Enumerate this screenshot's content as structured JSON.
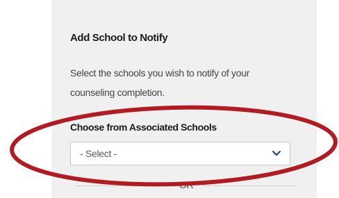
{
  "panel": {
    "title": "Add School to Notify",
    "description": "Select the schools you wish to notify of your counseling completion.",
    "associated_schools_label": "Choose from Associated Schools",
    "select": {
      "selected_value": "- Select -",
      "icon": "chevron-down-icon",
      "chevron_color": "#1f3a6e"
    },
    "divider_text": "OR"
  },
  "annotation": {
    "shape": "ellipse",
    "color": "#b01c22"
  }
}
